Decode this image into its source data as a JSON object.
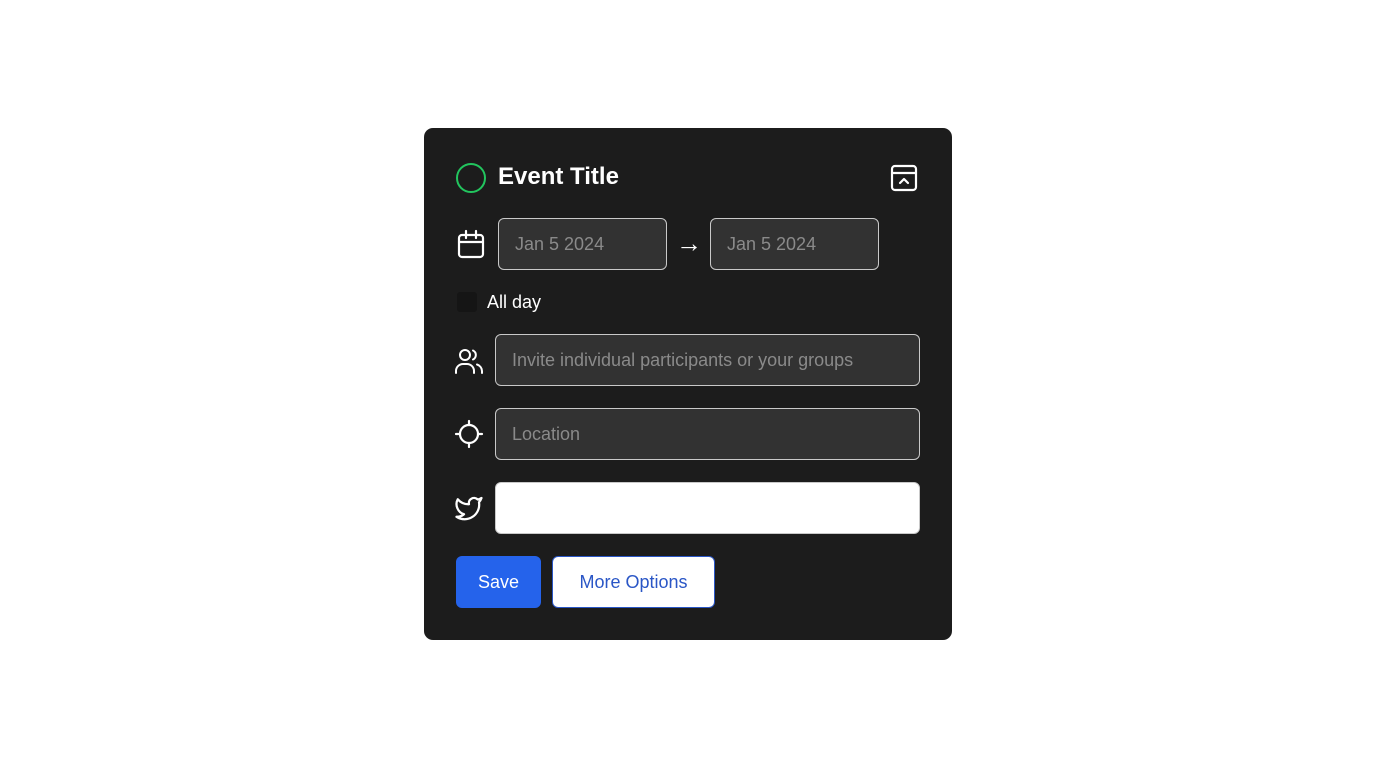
{
  "event": {
    "title": "Event Title",
    "status_color": "#22c55e"
  },
  "dates": {
    "start_placeholder": "Jan 5 2024",
    "end_placeholder": "Jan 5 2024",
    "arrow": "→"
  },
  "all_day": {
    "label": "All day",
    "checked": false
  },
  "participants": {
    "placeholder": "Invite individual participants or your groups"
  },
  "location": {
    "placeholder": "Location"
  },
  "social": {
    "value": ""
  },
  "actions": {
    "save_label": "Save",
    "more_label": "More Options"
  },
  "icons": {
    "status": "circle-icon",
    "collapse": "collapse-panel-icon",
    "date": "calendar-icon",
    "participants": "users-icon",
    "location": "crosshair-icon",
    "social": "twitter-icon"
  },
  "colors": {
    "card_background": "#1c1c1c",
    "accent": "#2563eb",
    "secondary_button_text": "#2a56c6"
  }
}
